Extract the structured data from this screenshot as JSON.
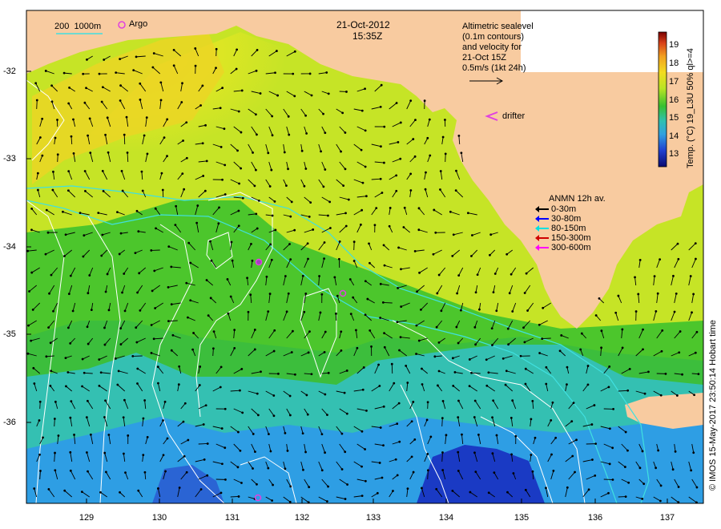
{
  "map": {
    "date": "21-Oct-2012",
    "time": "15:35Z",
    "bathy_legend": {
      "label_200": "200",
      "label_1000": "1000m"
    },
    "argo_label": "Argo",
    "altimetry_note": [
      "Altimetric sealevel",
      "(0.1m contours)",
      "and velocity for",
      "21-Oct 15Z",
      "0.5m/s (1kt 24h)"
    ],
    "drifter_label": "drifter",
    "colorbar": {
      "ticks": [
        "19",
        "18",
        "17",
        "16",
        "15",
        "14",
        "13"
      ],
      "label": "Temp. (°C) 19_L3U 50% ql>=4",
      "range": [
        12.5,
        19.5
      ]
    },
    "anmn_legend": {
      "title": "ANMN 12h av.",
      "items": [
        {
          "label": "0-30m",
          "color": "#000000"
        },
        {
          "label": "30-80m",
          "color": "#0000ff"
        },
        {
          "label": "80-150m",
          "color": "#00e0e0"
        },
        {
          "label": "150-300m",
          "color": "#d00000"
        },
        {
          "label": "300-600m",
          "color": "#ff00ff"
        }
      ]
    },
    "x_ticks": [
      "129",
      "130",
      "131",
      "132",
      "133",
      "134",
      "135",
      "136",
      "137"
    ],
    "y_ticks": [
      "-32",
      "-33",
      "-34",
      "-35",
      "-36"
    ],
    "credit": "© IMOS 15-May-2017 23:50:14 Hobart time",
    "colors": {
      "land": "#f8cba0",
      "warm": "#f2d21c",
      "mid": "#cfe820",
      "green": "#3ec22e",
      "cyan": "#2ec0c8",
      "blue": "#2a8ae0",
      "deep": "#1a2ab8",
      "contour": "#ffffff",
      "bathy": "#40e0e0",
      "marker": "#e040e0"
    }
  }
}
